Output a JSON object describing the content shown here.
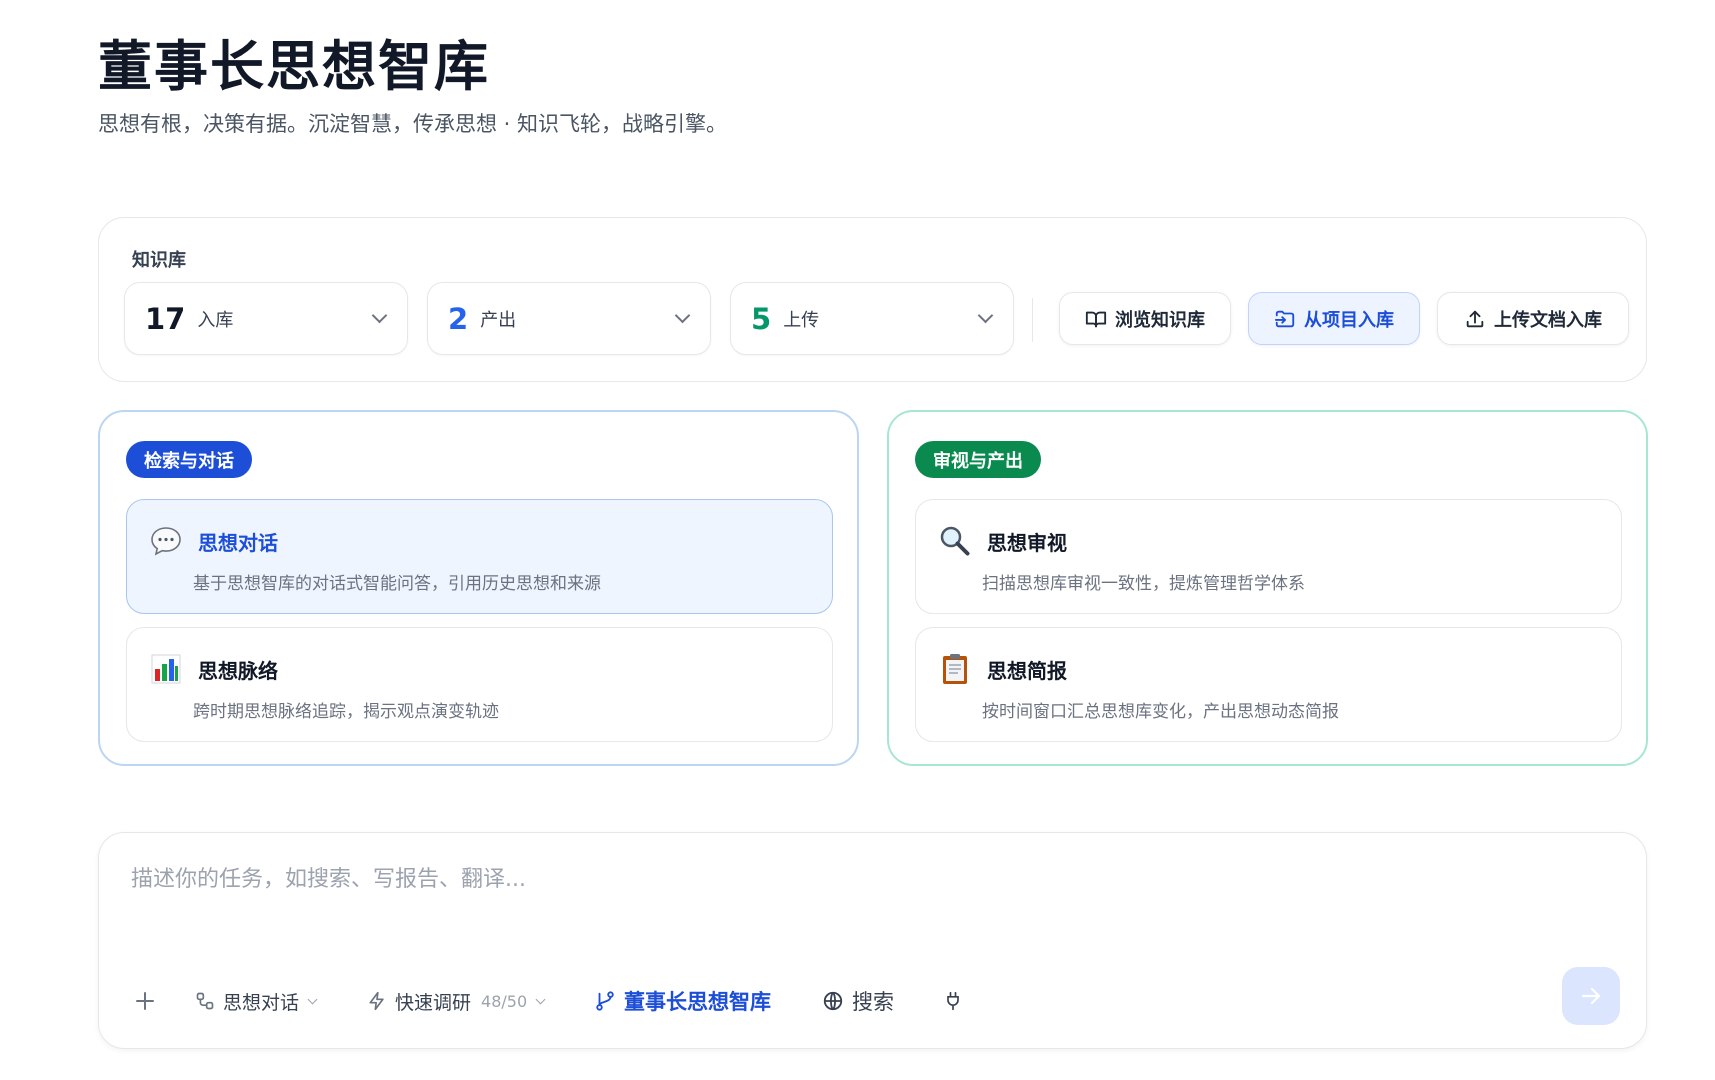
{
  "header": {
    "title": "董事长思想智库",
    "subtitle": "思想有根，决策有据。沉淀智慧，传承思想 · 知识飞轮，战略引擎。"
  },
  "knowledge_base": {
    "label": "知识库",
    "stats": [
      {
        "value": "17",
        "label": "入库",
        "color": "#111827"
      },
      {
        "value": "2",
        "label": "产出",
        "color": "#2563eb"
      },
      {
        "value": "5",
        "label": "上传",
        "color": "#059669"
      }
    ],
    "buttons": {
      "browse": "浏览知识库",
      "from_project": "从项目入库",
      "upload": "上传文档入库"
    }
  },
  "sections": {
    "left": {
      "pill": "检索与对话",
      "cards": [
        {
          "icon": "speech-bubble-icon",
          "title": "思想对话",
          "desc": "基于思想智库的对话式智能问答，引用历史思想和来源"
        },
        {
          "icon": "bar-chart-icon",
          "title": "思想脉络",
          "desc": "跨时期思想脉络追踪，揭示观点演变轨迹"
        }
      ]
    },
    "right": {
      "pill": "审视与产出",
      "cards": [
        {
          "icon": "magnifier-icon",
          "title": "思想审视",
          "desc": "扫描思想库审视一致性，提炼管理哲学体系"
        },
        {
          "icon": "clipboard-icon",
          "title": "思想简报",
          "desc": "按时间窗口汇总思想库变化，产出思想动态简报"
        }
      ]
    }
  },
  "composer": {
    "placeholder": "描述你的任务，如搜索、写报告、翻译...",
    "mode": "思想对话",
    "research": "快速调研",
    "research_count": "48/50",
    "kb": "董事长思想智库",
    "search": "搜索"
  },
  "colors": {
    "accent": "#1d4ed8",
    "green": "#0a8a4f"
  }
}
